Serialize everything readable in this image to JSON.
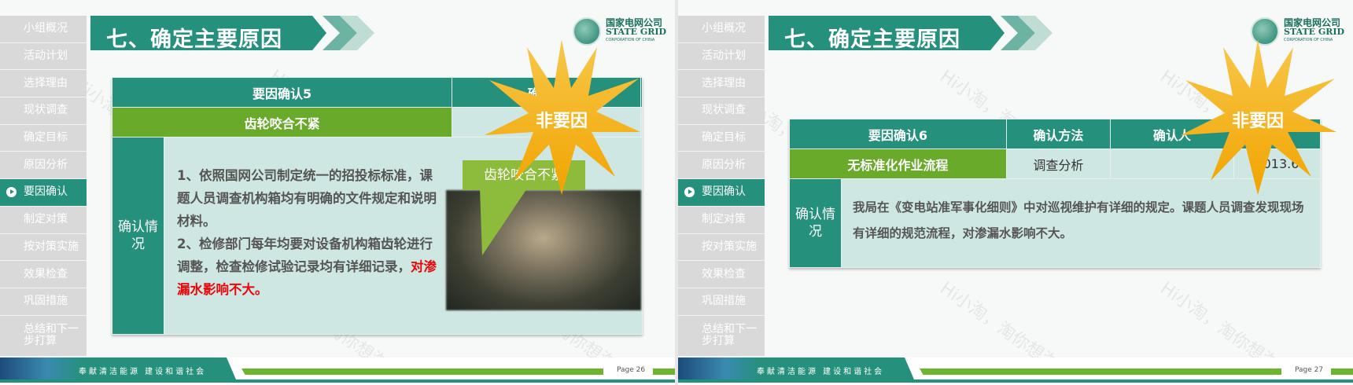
{
  "sidebar": {
    "items": [
      "小组概况",
      "活动计划",
      "选择理由",
      "现状调查",
      "确定目标",
      "原因分析",
      "要因确认",
      "制定对策",
      "按对策实施",
      "效果检查",
      "巩固措施",
      "总结和下一步打算"
    ],
    "active_index": 6
  },
  "title": "七、确定主要原因",
  "logo": {
    "cn": "国家电网公司",
    "en": "STATE GRID",
    "sub": "CORPORATION OF CHINA"
  },
  "watermark": "Hi小淘，淘你想淘!",
  "footer_slogan": "奉献清洁能源  建设和谐社会",
  "colors": {
    "teal": "#25907b",
    "green": "#6aaa2a",
    "light": "#cfe7e2",
    "star": "#f5a800",
    "red": "#e8080a"
  },
  "slide1": {
    "headers": [
      "要因确认5",
      "确认人",
      ""
    ],
    "factor": "齿轮咬合不紧",
    "row_cells": [
      "",
      ""
    ],
    "label": "确认情况",
    "text_1": "1、依照国网公司制定统一的招投标标准，课题人员调查机构箱均有明确的文件规定和说明材料。",
    "text_2": "2、检修部门每年均要对设备机构箱齿轮进行调整，检查检修试验记录均有详细记录，",
    "text_red": "对渗漏水影响不大。",
    "callout": "齿轮咬合不紧",
    "badge": "非要因",
    "page": "Page 26"
  },
  "slide2": {
    "headers": [
      "要因确认6",
      "确认方法",
      "确认人",
      ""
    ],
    "factor": "无标准化作业流程",
    "method": "调查分析",
    "person": "",
    "date": "2013.6",
    "label": "确认情况",
    "text": "我局在《变电站准军事化细则》中对巡视维护有详细的规定。课题人员调查发现现场有详细的规范流程，对渗漏水影响不大。",
    "badge": "非要因",
    "page": "Page 27"
  }
}
